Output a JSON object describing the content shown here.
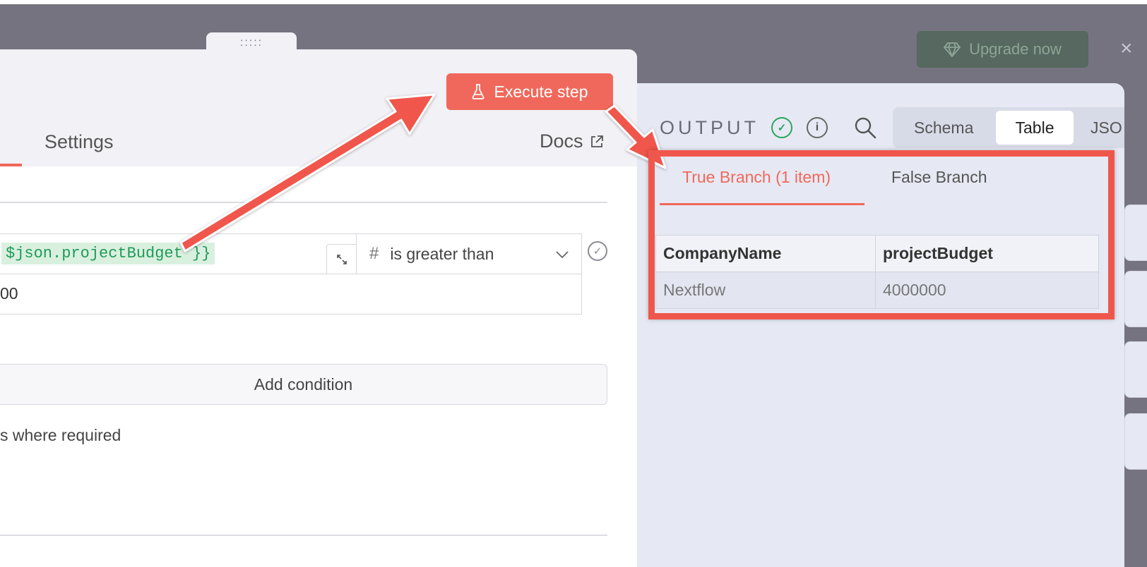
{
  "header": {
    "upgrade_label": "Upgrade now",
    "close_glyph": "×",
    "drag_handle_glyph": ":::::"
  },
  "left_panel": {
    "execute_label": "Execute step",
    "tab_settings": "Settings",
    "docs_label": "Docs",
    "expression": "$json.projectBudget }}",
    "operator_hash": "#",
    "operator_label": "is greater than",
    "value": "00",
    "add_condition_label": "Add condition",
    "note": "s where required"
  },
  "output": {
    "label": "OUTPUT",
    "views": {
      "schema": "Schema",
      "table": "Table",
      "json": "JSO"
    },
    "branch_true": "True Branch (1 item)",
    "branch_false": "False Branch",
    "columns": [
      "CompanyName",
      "projectBudget"
    ],
    "rows": [
      [
        "Nextflow",
        "4000000"
      ]
    ]
  },
  "icons": {
    "upgrade": "gem-icon",
    "execute": "flask-icon",
    "docs": "external-link-icon",
    "expand": "expand-icon",
    "chevron": "chevron-down-icon",
    "status_ok": "check-circle-icon",
    "info": "info-icon",
    "search": "search-icon"
  },
  "colors": {
    "accent": "#f0685b",
    "success": "#2aa55e",
    "annotation": "#f0574c",
    "upgrade_bg": "#56685f"
  }
}
